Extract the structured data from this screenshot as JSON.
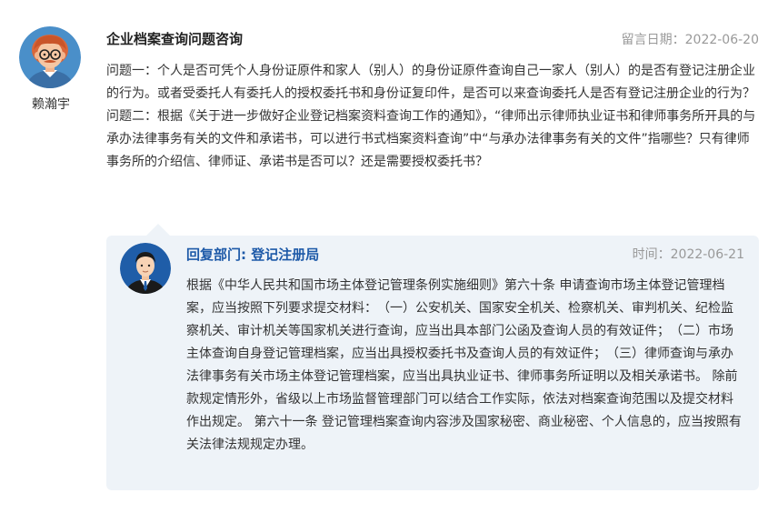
{
  "question": {
    "author": "赖瀚宇",
    "title": "企业档案查询问题咨询",
    "date": "留言日期：2022-06-20",
    "body_p1": "问题一：个人是否可凭个人身份证原件和家人（别人）的身份证原件查询自己一家人（别人）的是否有登记注册企业的行为。或者受委托人有委托人的授权委托书和身份证复印件，是否可以来查询委托人是否有登记注册企业的行为？",
    "body_p2": "问题二：根据《关于进一步做好企业登记档案资料查询工作的通知》，“律师出示律师执业证书和律师事务所开具的与承办法律事务有关的文件和承诺书，可以进行书式档案资料查询”中“与承办法律事务有关的文件”指哪些？只有律师事务所的介绍信、律师证、承诺书是否可以？还是需要授权委托书？"
  },
  "reply": {
    "department": "回复部门: 登记注册局",
    "date": "时间：2022-06-21",
    "body": "根据《中华人民共和国市场主体登记管理条例实施细则》第六十条 申请查询市场主体登记管理档案，应当按照下列要求提交材料：　（一）公安机关、国家安全机关、检察机关、审判机关、纪检监察机关、审计机关等国家机关进行查询，应当出具本部门公函及查询人员的有效证件；　（二）市场主体查询自身登记管理档案，应当出具授权委托书及查询人员的有效证件；　（三）律师查询与承办法律事务有关市场主体登记管理档案，应当出具执业证书、律师事务所证明以及相关承诺书。 除前款规定情形外，省级以上市场监督管理部门可以结合工作实际，依法对档案查询范围以及提交材料作出规定。 第六十一条 登记管理档案查询内容涉及国家秘密、商业秘密、个人信息的，应当按照有关法律法规规定办理。"
  },
  "colors": {
    "reply_bg": "#eef3f8",
    "dept_blue": "#1e5aa8",
    "date_gray": "#999999"
  },
  "icons": {
    "asker_avatar": "user-avatar-cartoon",
    "reply_avatar": "official-avatar-suit"
  }
}
